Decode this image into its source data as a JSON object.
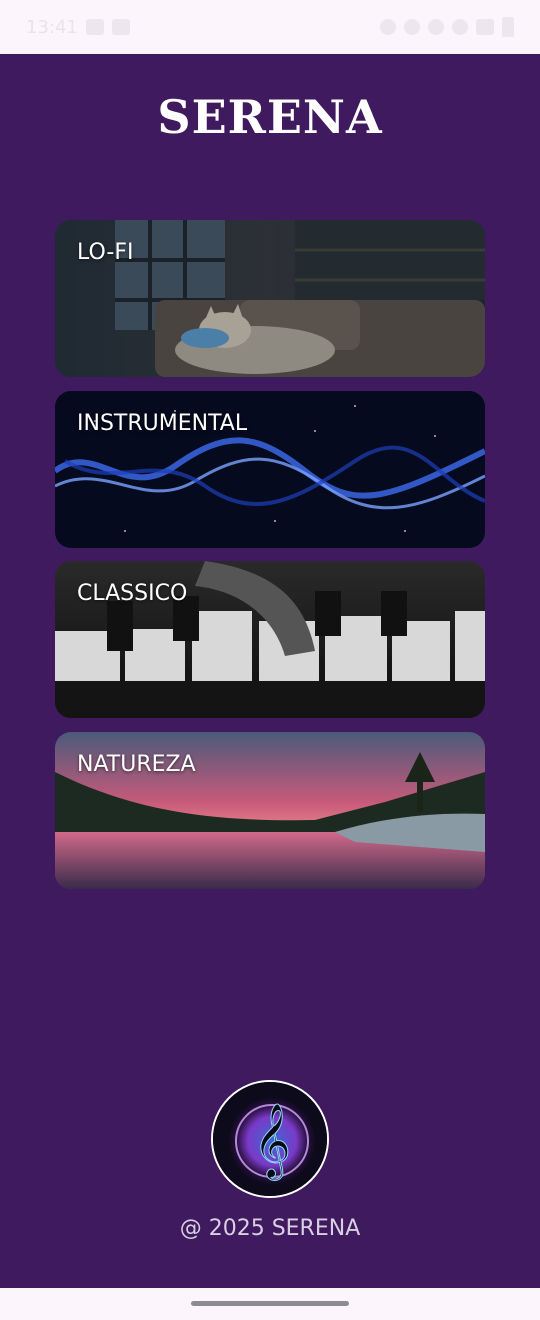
{
  "status_bar": {
    "time": "13:41"
  },
  "app": {
    "title": "SERENA",
    "footer": "@ 2025 SERENA"
  },
  "categories": [
    {
      "label": "LO-FI",
      "image": "sleeping-cat-lofi-room"
    },
    {
      "label": "INSTRUMENTAL",
      "image": "blue-smoke-waves"
    },
    {
      "label": "CLASSICO",
      "image": "piano-keys"
    },
    {
      "label": "NATUREZA",
      "image": "lake-sunset-landscape"
    }
  ],
  "logo": {
    "icon": "treble-clef-icon"
  },
  "colors": {
    "background": "#401a5e",
    "text": "#ffffff",
    "footer_text": "#d9cfe2"
  }
}
